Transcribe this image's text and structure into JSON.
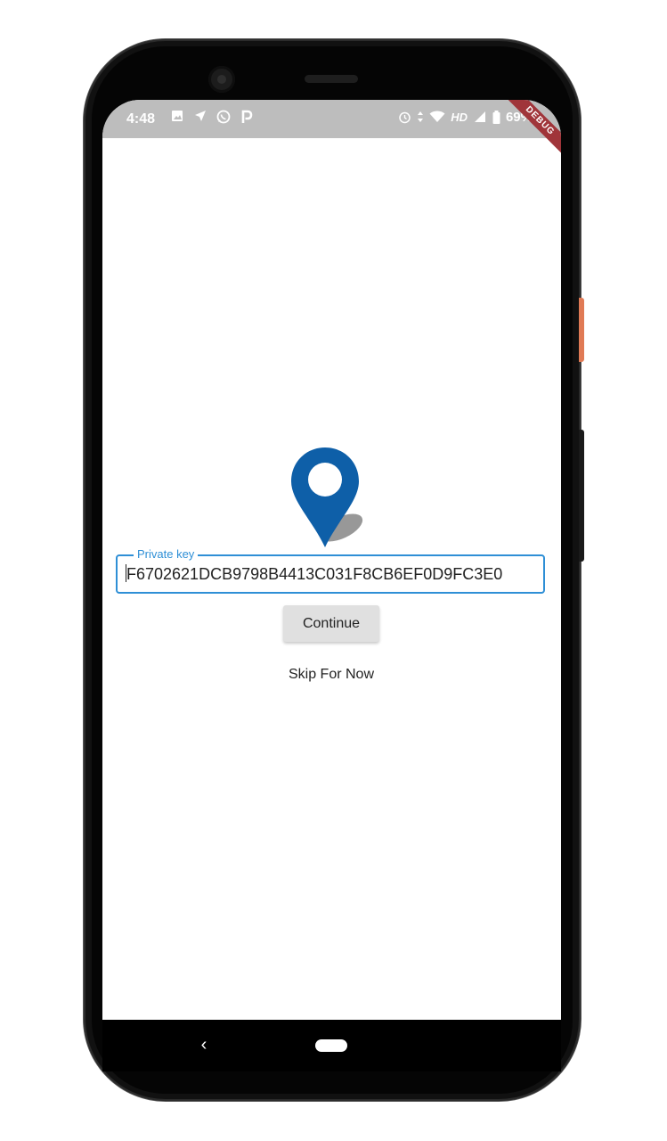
{
  "status_bar": {
    "time": "4:48",
    "left_icons": [
      "image-icon",
      "navigation-icon",
      "whatsapp-icon",
      "parking-icon"
    ],
    "right_icons": [
      "alarm-icon",
      "data-arrows-icon",
      "wifi-icon",
      "signal-icon"
    ],
    "network": "HD",
    "battery": "69%",
    "debug_banner": "DEBUG"
  },
  "app": {
    "private_key_label": "Private key",
    "private_key_value": "F6702621DCB9798B4413C031F8CB6EF0D9FC3E0",
    "continue_label": "Continue",
    "skip_label": "Skip For Now"
  },
  "colors": {
    "accent": "#2e8fd6",
    "pin": "#0e5fa8",
    "status_bar": "#bdbdbd",
    "button_bg": "#e0e0e0"
  },
  "nav_bar": {
    "back": "‹"
  }
}
